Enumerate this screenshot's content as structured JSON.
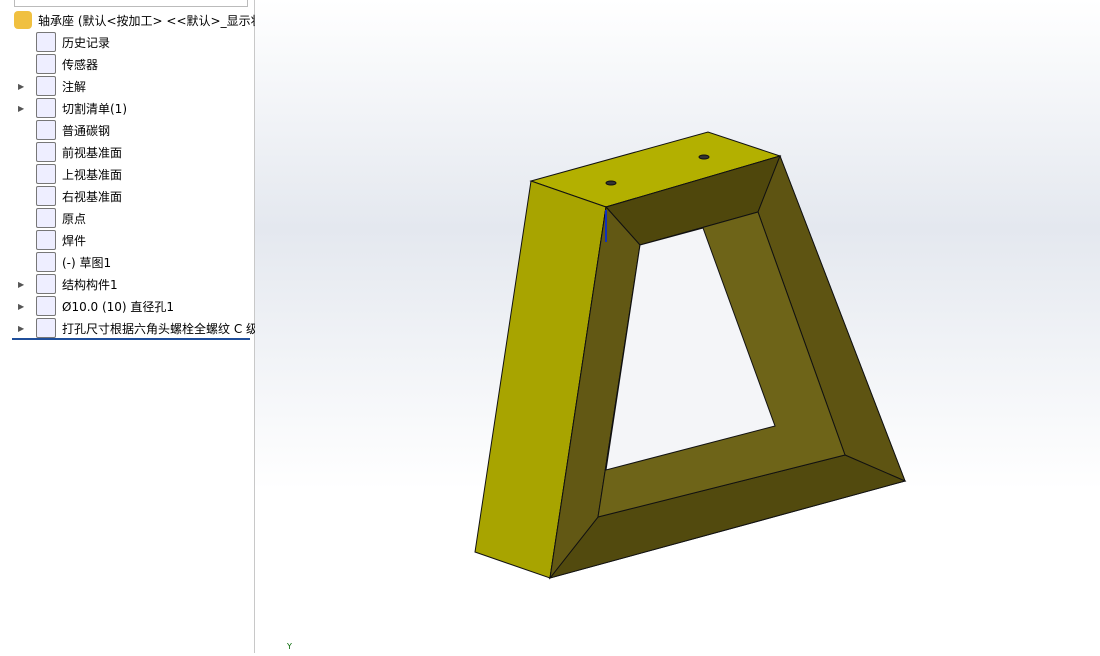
{
  "tree": {
    "root": "轴承座 (默认<按加工> <<默认>_显示状",
    "items": [
      {
        "label": "历史记录",
        "icon": "history-folder-icon",
        "expand": false
      },
      {
        "label": "传感器",
        "icon": "sensor-folder-icon",
        "expand": false
      },
      {
        "label": "注解",
        "icon": "annotation-folder-icon",
        "expand": true
      },
      {
        "label": "切割清单(1)",
        "icon": "cut-list-icon",
        "expand": true
      },
      {
        "label": "普通碳钢",
        "icon": "material-icon",
        "expand": false
      },
      {
        "label": "前视基准面",
        "icon": "plane-icon",
        "expand": false
      },
      {
        "label": "上视基准面",
        "icon": "plane-icon",
        "expand": false
      },
      {
        "label": "右视基准面",
        "icon": "plane-icon",
        "expand": false
      },
      {
        "label": "原点",
        "icon": "origin-icon",
        "expand": false
      },
      {
        "label": "焊件",
        "icon": "weldment-icon",
        "expand": false
      },
      {
        "label": "(-) 草图1",
        "icon": "sketch-icon",
        "expand": false
      },
      {
        "label": "结构构件1",
        "icon": "structural-member-icon",
        "expand": true
      },
      {
        "label": "Ø10.0 (10) 直径孔1",
        "icon": "hole-wizard-icon",
        "expand": true
      },
      {
        "label": "打孔尺寸根据六角头螺栓全螺纹 C 级",
        "icon": "hole-wizard-icon",
        "expand": true
      }
    ]
  },
  "view": {
    "axis_label": "Y"
  },
  "colors": {
    "face_light": "#a8a400",
    "face_top": "#b3b000",
    "face_dark": "#584f10"
  }
}
